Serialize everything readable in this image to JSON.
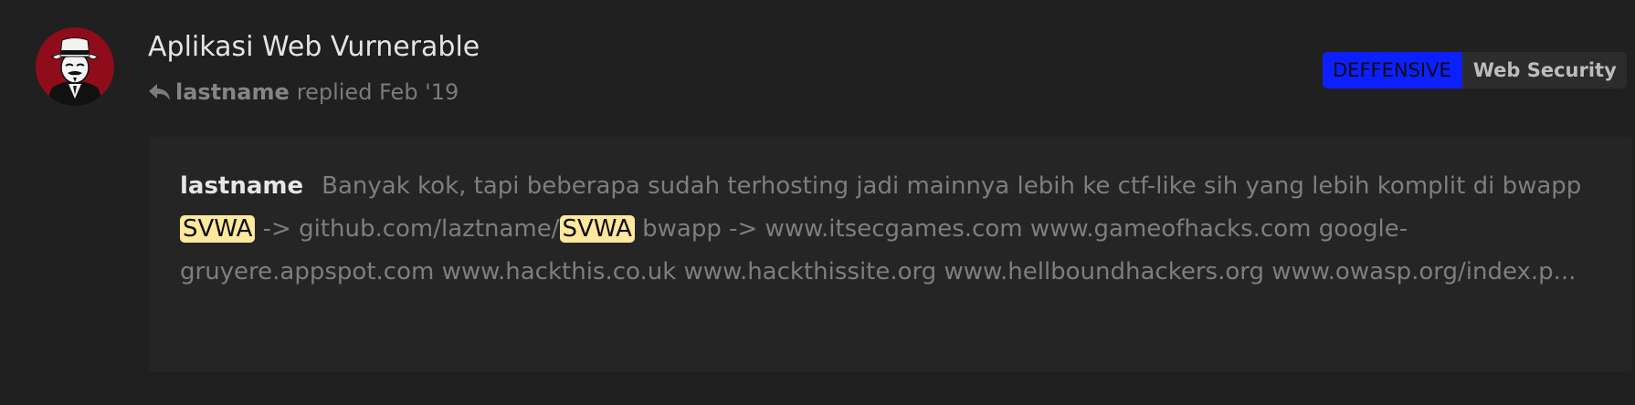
{
  "topic": {
    "title": "Aplikasi Web Vurnerable"
  },
  "reply": {
    "icon": "reply-icon",
    "username": "lastname",
    "action_text": "replied Feb '19"
  },
  "tags": [
    {
      "label": "DEFFENSIVE",
      "color": "#0c20ff"
    },
    {
      "label": "Web Security",
      "color": "#2c2c2c"
    }
  ],
  "excerpt": {
    "author": "lastname",
    "segments": [
      "Banyak kok, tapi beberapa sudah terhosting jadi mainnya lebih ke ctf-like sih yang lebih komplit di bwapp",
      "SVWA",
      "-> github.com/laztname/",
      "SVWA",
      "bwapp -> www.itsecgames.com www.gameofhacks.com google-gruyere.appspot.com www.hackthis.co.uk www.hackthissite.org www.hellboundhackers.org www.owasp.org/index.p..."
    ],
    "highlight_color": "#ffe89c"
  },
  "colors": {
    "background": "#202020",
    "excerpt_background": "#252525",
    "title": "#e4e4e4",
    "muted": "#7b7b7b"
  }
}
